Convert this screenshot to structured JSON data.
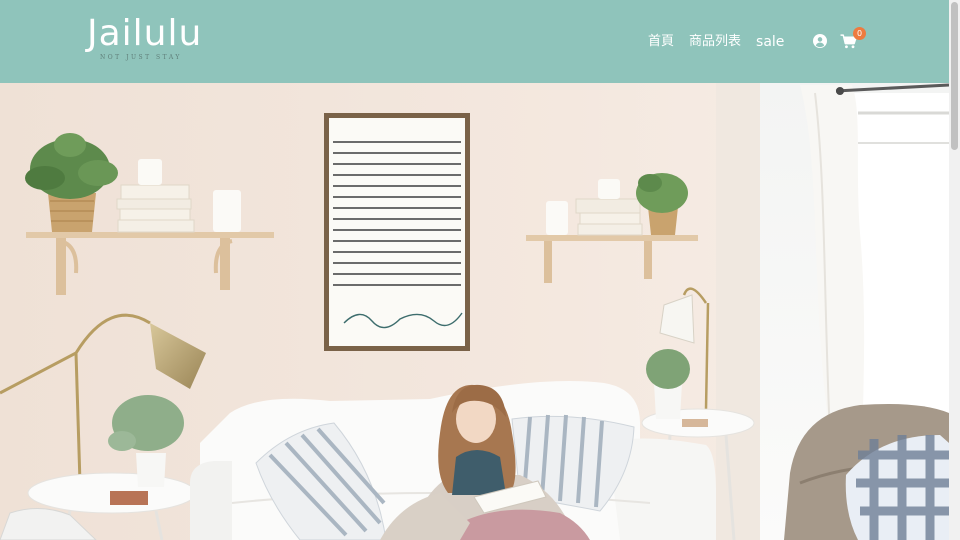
{
  "brand": {
    "name": "Jailulu",
    "tagline": "NOT JUST STAY"
  },
  "nav": {
    "items": [
      "首頁",
      "商品列表",
      "sale"
    ]
  },
  "cart": {
    "count": "0"
  },
  "icons": {
    "user": "user-circle-icon",
    "cart": "shopping-cart-icon"
  },
  "hero": {
    "frame_text": "For what it's worth, it's never too late, or in my case, too early to be whoever you want to be. There's no time limit, stop whenever you want. You can change or stay the same, there are no rules to this thing. We can make the best or the worst of it. I hope you make the best of it. And I hope you see things that startle you. I hope you feel things you have never felt before. I hope you meet people with a different point of view. I hope you live a life you're proud of. If you find you are not, I hope you have the courage to start all over again.",
    "frame_signature": "- F Scott Fitzgerald"
  },
  "colors": {
    "header_bg": "#8fc4bb",
    "badge": "#ee7b3f",
    "wall": "#f1e4db"
  }
}
